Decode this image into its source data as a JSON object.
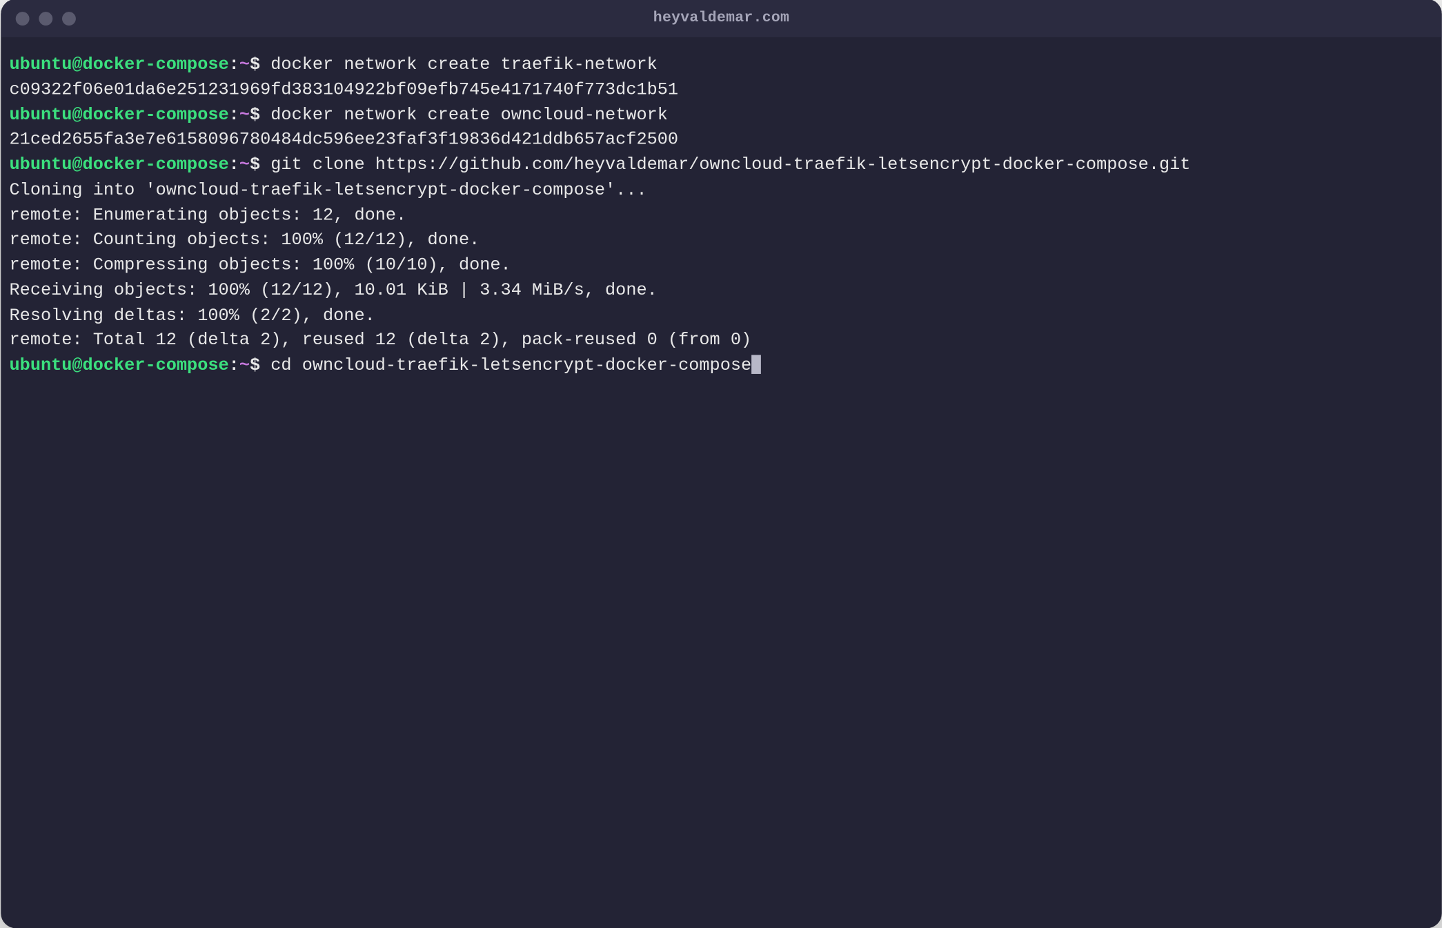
{
  "window": {
    "title": "heyvaldemar.com"
  },
  "prompt": {
    "user_host": "ubuntu@docker-compose",
    "sep1": ":",
    "path": "~",
    "sep2": "$"
  },
  "lines": [
    {
      "t": "prompt",
      "cmd": " docker network create traefik-network"
    },
    {
      "t": "out",
      "txt": "c09322f06e01da6e251231969fd383104922bf09efb745e4171740f773dc1b51"
    },
    {
      "t": "prompt",
      "cmd": " docker network create owncloud-network"
    },
    {
      "t": "out",
      "txt": "21ced2655fa3e7e6158096780484dc596ee23faf3f19836d421ddb657acf2500"
    },
    {
      "t": "prompt",
      "cmd": " git clone https://github.com/heyvaldemar/owncloud-traefik-letsencrypt-docker-compose.git"
    },
    {
      "t": "out",
      "txt": "Cloning into 'owncloud-traefik-letsencrypt-docker-compose'..."
    },
    {
      "t": "out",
      "txt": "remote: Enumerating objects: 12, done."
    },
    {
      "t": "out",
      "txt": "remote: Counting objects: 100% (12/12), done."
    },
    {
      "t": "out",
      "txt": "remote: Compressing objects: 100% (10/10), done."
    },
    {
      "t": "out",
      "txt": "Receiving objects: 100% (12/12), 10.01 KiB | 3.34 MiB/s, done."
    },
    {
      "t": "out",
      "txt": "Resolving deltas: 100% (2/2), done."
    },
    {
      "t": "out",
      "txt": "remote: Total 12 (delta 2), reused 12 (delta 2), pack-reused 0 (from 0)"
    },
    {
      "t": "prompt",
      "cmd": " cd owncloud-traefik-letsencrypt-docker-compose",
      "cursor": true
    }
  ]
}
